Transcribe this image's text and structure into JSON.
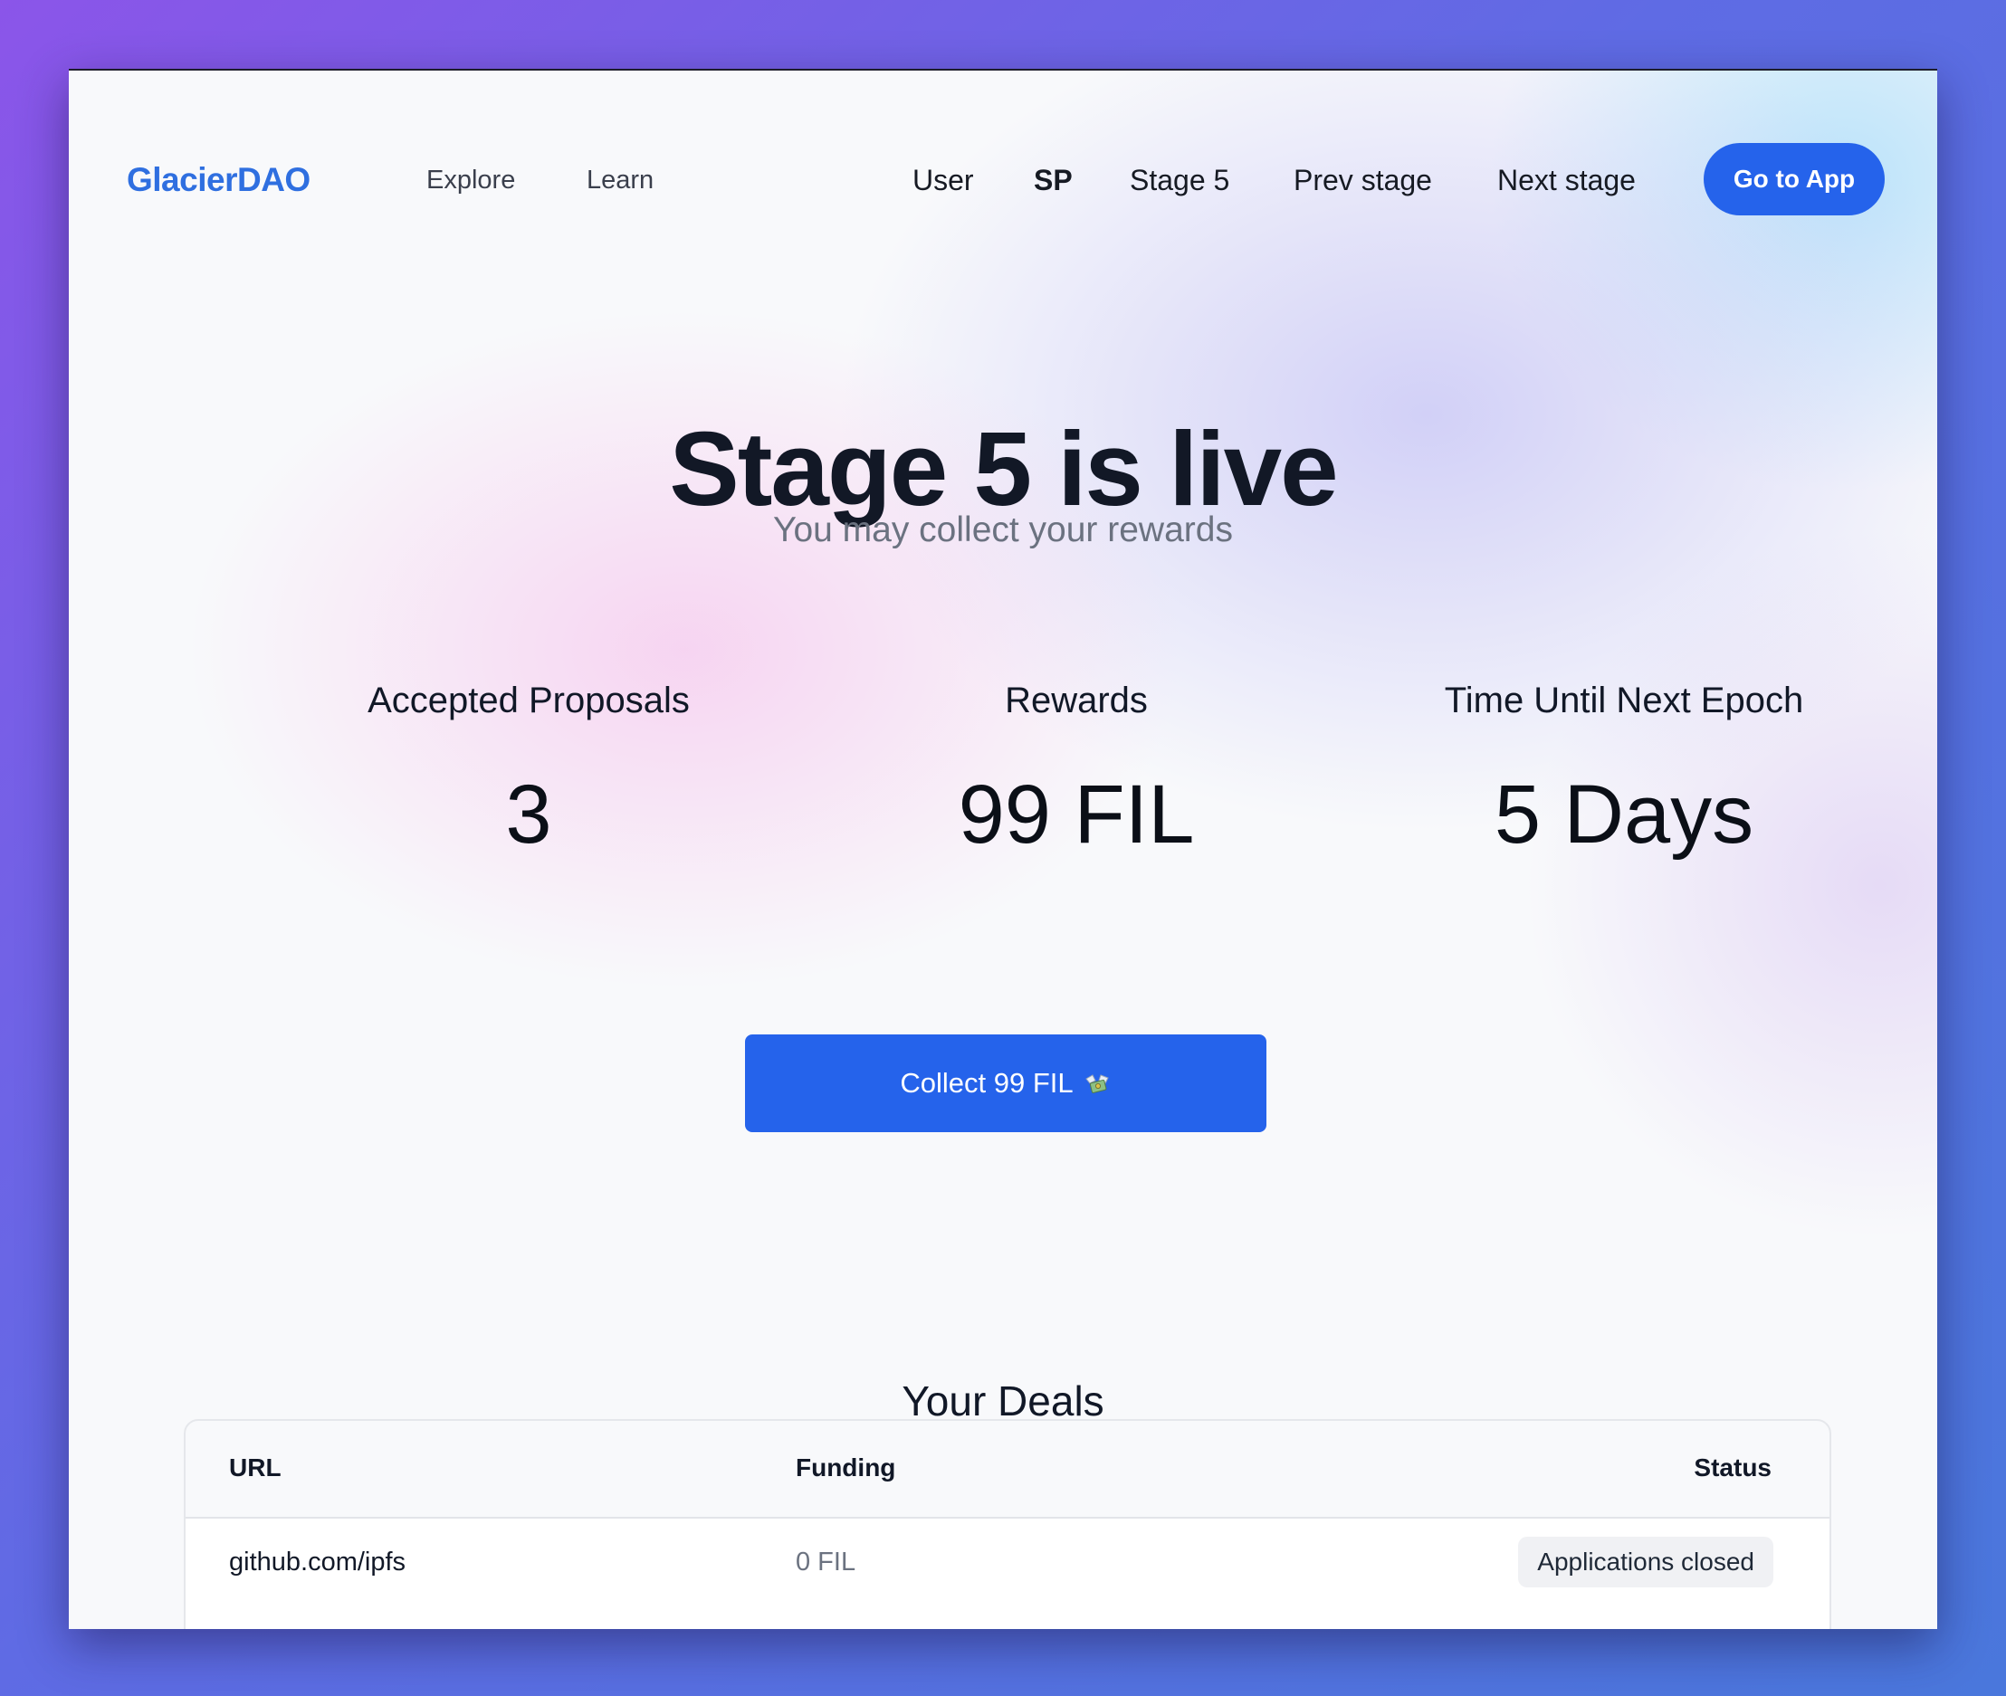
{
  "header": {
    "logo": "GlacierDAO",
    "nav_left": [
      "Explore",
      "Learn"
    ],
    "nav_right": [
      {
        "label": "User",
        "active": false
      },
      {
        "label": "SP",
        "active": true
      },
      {
        "label": "Stage 5",
        "active": false
      },
      {
        "label": "Prev stage",
        "active": false
      },
      {
        "label": "Next stage",
        "active": false
      }
    ],
    "cta": "Go to App"
  },
  "hero": {
    "title": "Stage 5 is live",
    "subtitle": "You may collect your rewards"
  },
  "stats": [
    {
      "label": "Accepted Proposals",
      "value": "3"
    },
    {
      "label": "Rewards",
      "value": "99 FIL"
    },
    {
      "label": "Time Until Next Epoch",
      "value": "5 Days"
    }
  ],
  "collect": {
    "label": "Collect 99 FIL",
    "icon": "money-with-wings-icon"
  },
  "deals": {
    "title": "Your Deals",
    "columns": [
      "URL",
      "Funding",
      "Status"
    ],
    "rows": [
      {
        "url": "github.com/ipfs",
        "funding": "0 FIL",
        "status": "Applications closed"
      }
    ]
  },
  "colors": {
    "accent": "#2563eb",
    "logo": "#2f6fe0",
    "heading": "#121826",
    "muted": "#6b7280"
  }
}
